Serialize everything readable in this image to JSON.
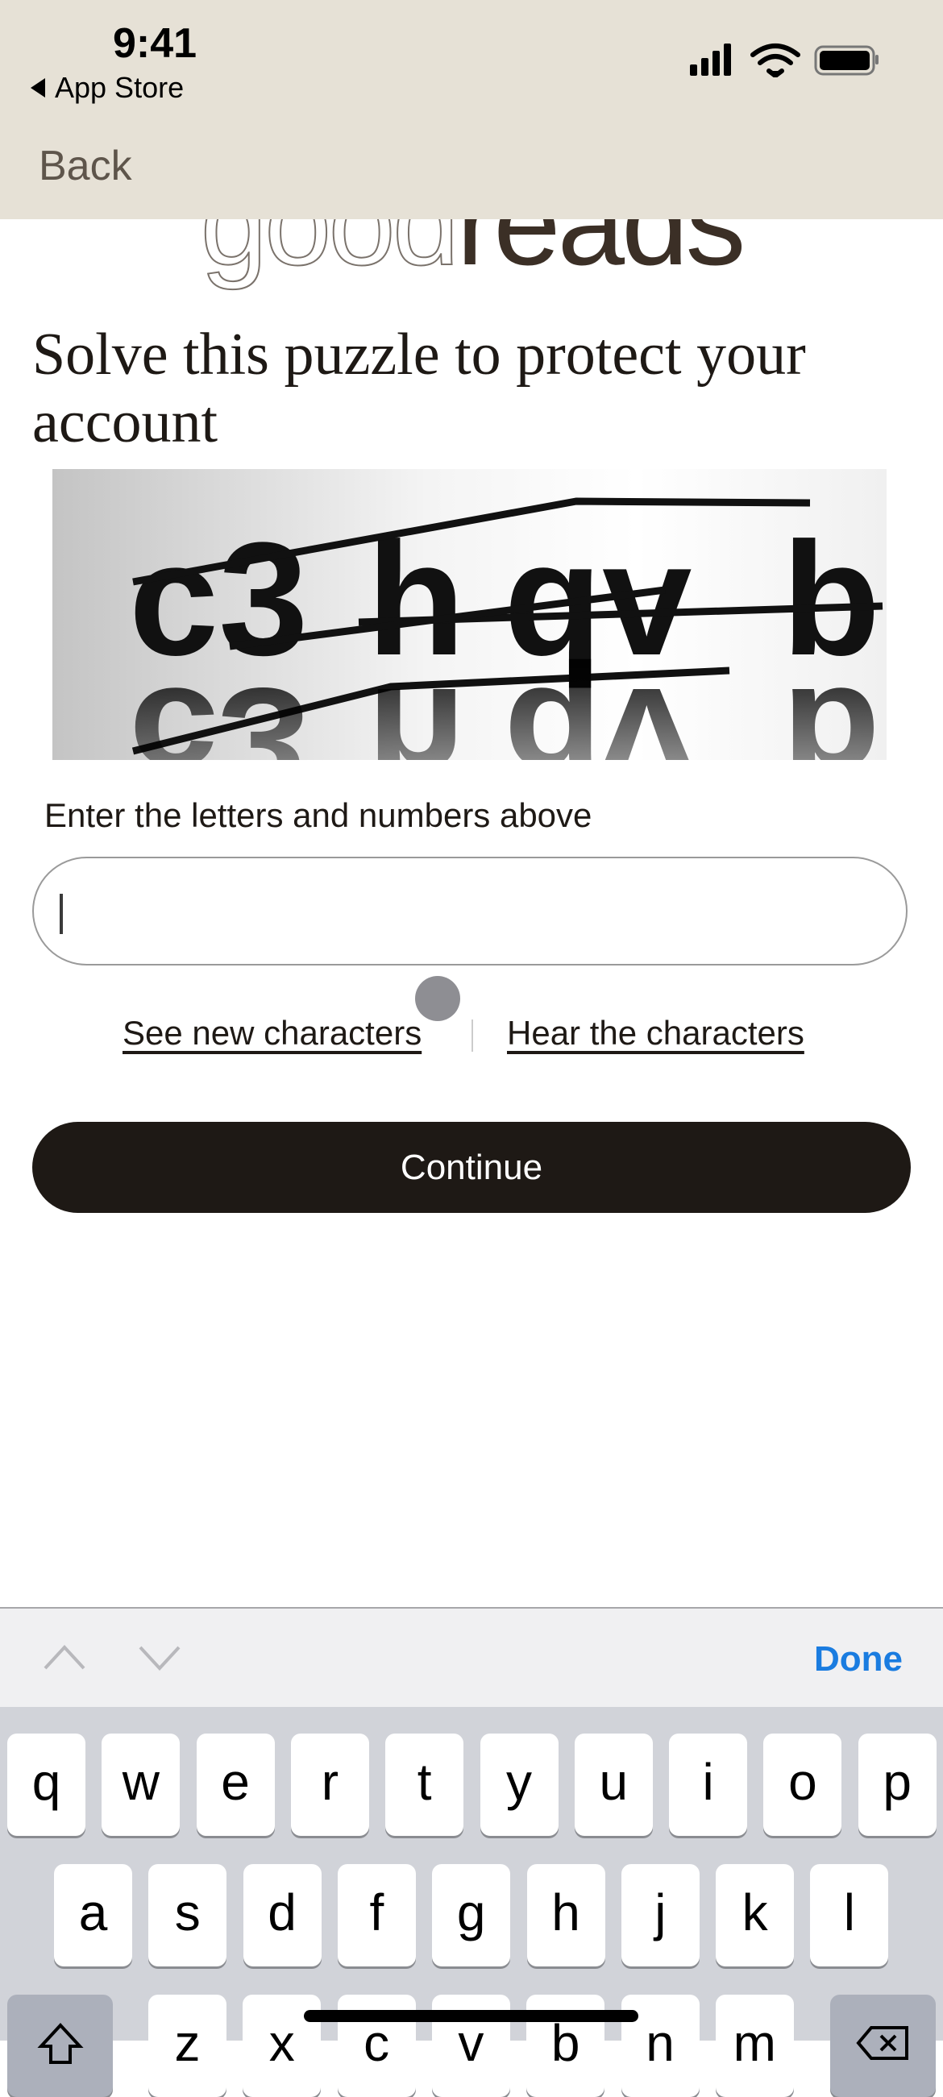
{
  "status_bar": {
    "time": "9:41",
    "back_app": "App Store",
    "icons": [
      "signal-icon",
      "wifi-icon",
      "battery-icon"
    ]
  },
  "nav": {
    "back_label": "Back"
  },
  "logo": {
    "part1": "good",
    "part2": "reads"
  },
  "title": "Solve this puzzle to protect your account",
  "captcha": {
    "text": "c3hqvb"
  },
  "form": {
    "label": "Enter the letters and numbers above",
    "value": ""
  },
  "links": {
    "new_chars": "See new characters",
    "hear_chars": "Hear the characters"
  },
  "continue_label": "Continue",
  "accessory": {
    "done_label": "Done"
  },
  "keyboard": {
    "row1": [
      "q",
      "w",
      "e",
      "r",
      "t",
      "y",
      "u",
      "i",
      "o",
      "p"
    ],
    "row2": [
      "a",
      "s",
      "d",
      "f",
      "g",
      "h",
      "j",
      "k",
      "l"
    ],
    "row3": [
      "z",
      "x",
      "c",
      "v",
      "b",
      "n",
      "m"
    ]
  },
  "colors": {
    "header_bg": "#e6e1d6",
    "button_bg": "#1e1915",
    "done_blue": "#1a7ce0"
  }
}
